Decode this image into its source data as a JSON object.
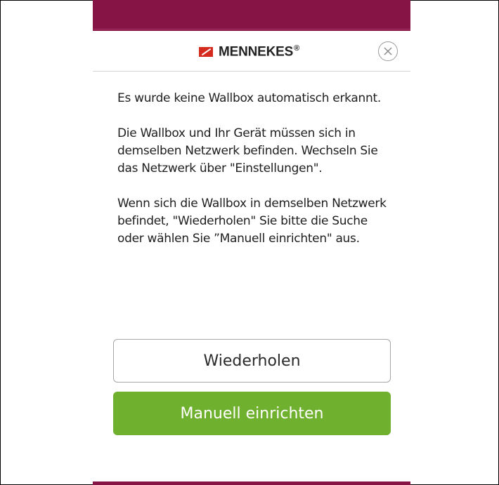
{
  "brand": {
    "logo_text": "MENNEKES",
    "logo_registered": "®",
    "primary_color": "#861444",
    "accent_color": "#d52b1e"
  },
  "dialog": {
    "close_icon": "close-circle-icon",
    "paragraphs": [
      "Es wurde keine Wallbox automatisch erkannt.",
      "Die Wallbox und Ihr Gerät müssen sich in demselben Netzwerk befinden. Wechseln Sie das Netzwerk über \"Einstellungen\".",
      "Wenn sich die Wallbox in demselben Netzwerk befindet, \"Wiederholen\" Sie bitte die Suche oder wählen Sie ”Manuell einrichten\" aus."
    ],
    "retry_label": "Wiederholen",
    "manual_label": "Manuell einrichten",
    "manual_color": "#6fb02f"
  }
}
